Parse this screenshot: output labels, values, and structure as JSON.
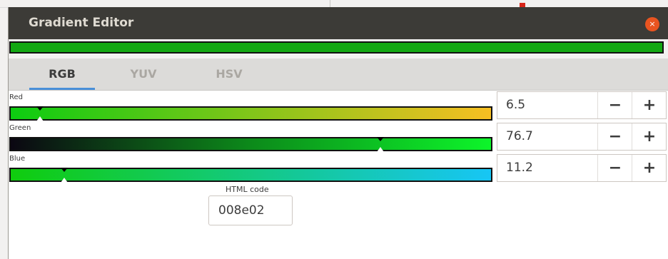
{
  "window": {
    "title": "Gradient Editor",
    "close_label": "×"
  },
  "tabs": [
    {
      "label": "RGB",
      "active": true
    },
    {
      "label": "YUV",
      "active": false
    },
    {
      "label": "HSV",
      "active": false
    }
  ],
  "sliders": [
    {
      "label": "Red",
      "value": "6.5",
      "minus": "−",
      "plus": "+"
    },
    {
      "label": "Green",
      "value": "76.7",
      "minus": "−",
      "plus": "+"
    },
    {
      "label": "Blue",
      "value": "11.2",
      "minus": "−",
      "plus": "+"
    }
  ],
  "html_code": {
    "label": "HTML code",
    "value": "008e02"
  },
  "colors": {
    "current": "#008e02",
    "red_track": [
      "#0ccc11",
      "#f7bf22"
    ],
    "green_track": [
      "#0b0712",
      "#0df52a"
    ],
    "blue_track": [
      "#10cc0d",
      "#17c6f5"
    ],
    "close": "#e95420",
    "tab_underline": "#4a90d9"
  }
}
